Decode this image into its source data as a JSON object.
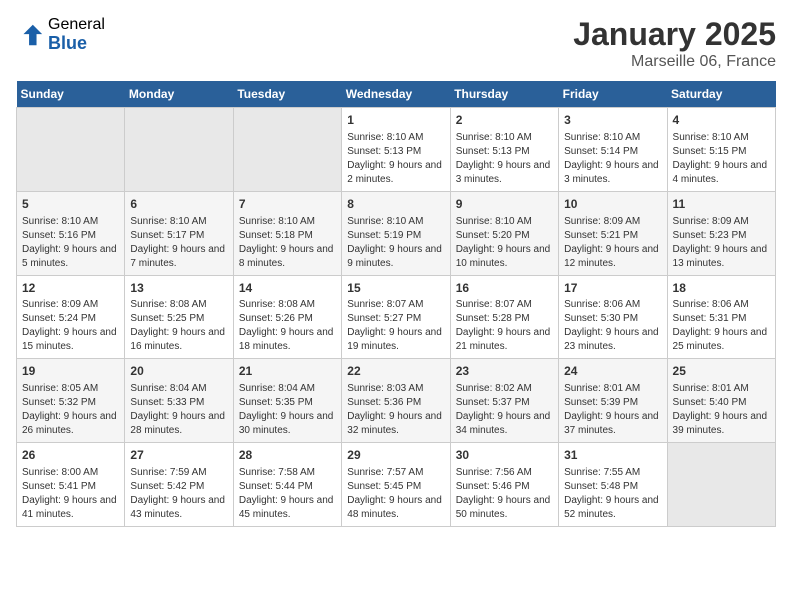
{
  "header": {
    "logo_general": "General",
    "logo_blue": "Blue",
    "title": "January 2025",
    "subtitle": "Marseille 06, France"
  },
  "weekdays": [
    "Sunday",
    "Monday",
    "Tuesday",
    "Wednesday",
    "Thursday",
    "Friday",
    "Saturday"
  ],
  "weeks": [
    [
      {
        "day": "",
        "info": ""
      },
      {
        "day": "",
        "info": ""
      },
      {
        "day": "",
        "info": ""
      },
      {
        "day": "1",
        "info": "Sunrise: 8:10 AM\nSunset: 5:13 PM\nDaylight: 9 hours and 2 minutes."
      },
      {
        "day": "2",
        "info": "Sunrise: 8:10 AM\nSunset: 5:13 PM\nDaylight: 9 hours and 3 minutes."
      },
      {
        "day": "3",
        "info": "Sunrise: 8:10 AM\nSunset: 5:14 PM\nDaylight: 9 hours and 3 minutes."
      },
      {
        "day": "4",
        "info": "Sunrise: 8:10 AM\nSunset: 5:15 PM\nDaylight: 9 hours and 4 minutes."
      }
    ],
    [
      {
        "day": "5",
        "info": "Sunrise: 8:10 AM\nSunset: 5:16 PM\nDaylight: 9 hours and 5 minutes."
      },
      {
        "day": "6",
        "info": "Sunrise: 8:10 AM\nSunset: 5:17 PM\nDaylight: 9 hours and 7 minutes."
      },
      {
        "day": "7",
        "info": "Sunrise: 8:10 AM\nSunset: 5:18 PM\nDaylight: 9 hours and 8 minutes."
      },
      {
        "day": "8",
        "info": "Sunrise: 8:10 AM\nSunset: 5:19 PM\nDaylight: 9 hours and 9 minutes."
      },
      {
        "day": "9",
        "info": "Sunrise: 8:10 AM\nSunset: 5:20 PM\nDaylight: 9 hours and 10 minutes."
      },
      {
        "day": "10",
        "info": "Sunrise: 8:09 AM\nSunset: 5:21 PM\nDaylight: 9 hours and 12 minutes."
      },
      {
        "day": "11",
        "info": "Sunrise: 8:09 AM\nSunset: 5:23 PM\nDaylight: 9 hours and 13 minutes."
      }
    ],
    [
      {
        "day": "12",
        "info": "Sunrise: 8:09 AM\nSunset: 5:24 PM\nDaylight: 9 hours and 15 minutes."
      },
      {
        "day": "13",
        "info": "Sunrise: 8:08 AM\nSunset: 5:25 PM\nDaylight: 9 hours and 16 minutes."
      },
      {
        "day": "14",
        "info": "Sunrise: 8:08 AM\nSunset: 5:26 PM\nDaylight: 9 hours and 18 minutes."
      },
      {
        "day": "15",
        "info": "Sunrise: 8:07 AM\nSunset: 5:27 PM\nDaylight: 9 hours and 19 minutes."
      },
      {
        "day": "16",
        "info": "Sunrise: 8:07 AM\nSunset: 5:28 PM\nDaylight: 9 hours and 21 minutes."
      },
      {
        "day": "17",
        "info": "Sunrise: 8:06 AM\nSunset: 5:30 PM\nDaylight: 9 hours and 23 minutes."
      },
      {
        "day": "18",
        "info": "Sunrise: 8:06 AM\nSunset: 5:31 PM\nDaylight: 9 hours and 25 minutes."
      }
    ],
    [
      {
        "day": "19",
        "info": "Sunrise: 8:05 AM\nSunset: 5:32 PM\nDaylight: 9 hours and 26 minutes."
      },
      {
        "day": "20",
        "info": "Sunrise: 8:04 AM\nSunset: 5:33 PM\nDaylight: 9 hours and 28 minutes."
      },
      {
        "day": "21",
        "info": "Sunrise: 8:04 AM\nSunset: 5:35 PM\nDaylight: 9 hours and 30 minutes."
      },
      {
        "day": "22",
        "info": "Sunrise: 8:03 AM\nSunset: 5:36 PM\nDaylight: 9 hours and 32 minutes."
      },
      {
        "day": "23",
        "info": "Sunrise: 8:02 AM\nSunset: 5:37 PM\nDaylight: 9 hours and 34 minutes."
      },
      {
        "day": "24",
        "info": "Sunrise: 8:01 AM\nSunset: 5:39 PM\nDaylight: 9 hours and 37 minutes."
      },
      {
        "day": "25",
        "info": "Sunrise: 8:01 AM\nSunset: 5:40 PM\nDaylight: 9 hours and 39 minutes."
      }
    ],
    [
      {
        "day": "26",
        "info": "Sunrise: 8:00 AM\nSunset: 5:41 PM\nDaylight: 9 hours and 41 minutes."
      },
      {
        "day": "27",
        "info": "Sunrise: 7:59 AM\nSunset: 5:42 PM\nDaylight: 9 hours and 43 minutes."
      },
      {
        "day": "28",
        "info": "Sunrise: 7:58 AM\nSunset: 5:44 PM\nDaylight: 9 hours and 45 minutes."
      },
      {
        "day": "29",
        "info": "Sunrise: 7:57 AM\nSunset: 5:45 PM\nDaylight: 9 hours and 48 minutes."
      },
      {
        "day": "30",
        "info": "Sunrise: 7:56 AM\nSunset: 5:46 PM\nDaylight: 9 hours and 50 minutes."
      },
      {
        "day": "31",
        "info": "Sunrise: 7:55 AM\nSunset: 5:48 PM\nDaylight: 9 hours and 52 minutes."
      },
      {
        "day": "",
        "info": ""
      }
    ]
  ]
}
